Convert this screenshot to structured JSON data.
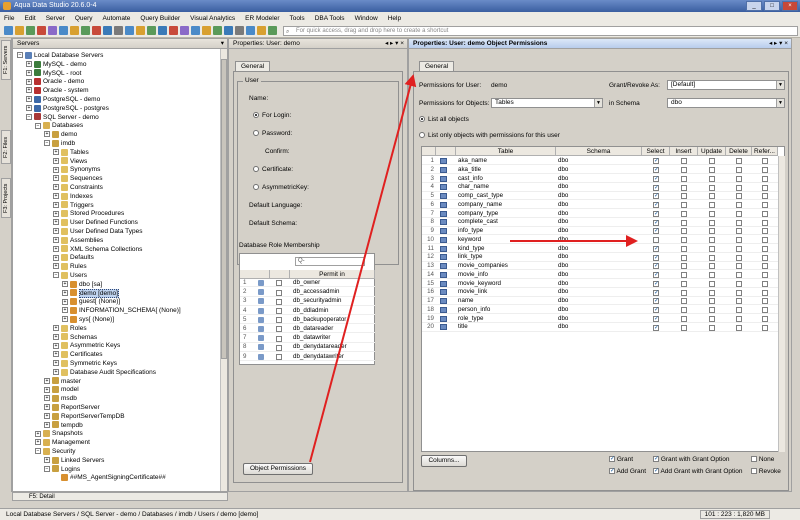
{
  "window": {
    "title": "Aqua Data Studio 20.6.0-4"
  },
  "menu": [
    "File",
    "Edit",
    "Server",
    "Query",
    "Automate",
    "Query Builder",
    "Visual Analytics",
    "ER Modeler",
    "Tools",
    "DBA Tools",
    "Window",
    "Help"
  ],
  "toolbar": {
    "shortcut_placeholder": "For quick access, drag and drop here to create a shortcut"
  },
  "vtabs": [
    "F1: Servers",
    "F2: Files",
    "F3: Projects"
  ],
  "servers": {
    "title": "Servers",
    "tree": [
      {
        "label": "Local Database Servers",
        "d": 0,
        "exp": "-",
        "ic": "#5a80b8"
      },
      {
        "label": "MySQL - demo",
        "d": 1,
        "exp": "+",
        "ic": "#3c7c3c"
      },
      {
        "label": "MySQL - root",
        "d": 1,
        "exp": "+",
        "ic": "#3c7c3c"
      },
      {
        "label": "Oracle - demo",
        "d": 1,
        "exp": "+",
        "ic": "#b83030"
      },
      {
        "label": "Oracle - system",
        "d": 1,
        "exp": "+",
        "ic": "#b83030"
      },
      {
        "label": "PostgreSQL - demo",
        "d": 1,
        "exp": "+",
        "ic": "#3c68a8"
      },
      {
        "label": "PostgreSQL - postgres",
        "d": 1,
        "exp": "+",
        "ic": "#3c68a8"
      },
      {
        "label": "SQL Server - demo",
        "d": 1,
        "exp": "-",
        "ic": "#a83838"
      },
      {
        "label": "Databases",
        "d": 2,
        "exp": "-",
        "ic": "#d8b050"
      },
      {
        "label": "demo",
        "d": 3,
        "exp": "+",
        "ic": "#c8a040"
      },
      {
        "label": "imdb",
        "d": 3,
        "exp": "-",
        "ic": "#c8a040"
      },
      {
        "label": "Tables",
        "d": 4,
        "exp": "+",
        "ic": "#e0c060"
      },
      {
        "label": "Views",
        "d": 4,
        "exp": "+",
        "ic": "#e0c060"
      },
      {
        "label": "Synonyms",
        "d": 4,
        "exp": "+",
        "ic": "#e0c060"
      },
      {
        "label": "Sequences",
        "d": 4,
        "exp": "+",
        "ic": "#e0c060"
      },
      {
        "label": "Constraints",
        "d": 4,
        "exp": "+",
        "ic": "#e0c060"
      },
      {
        "label": "Indexes",
        "d": 4,
        "exp": "+",
        "ic": "#e0c060"
      },
      {
        "label": "Triggers",
        "d": 4,
        "exp": "+",
        "ic": "#e0c060"
      },
      {
        "label": "Stored Procedures",
        "d": 4,
        "exp": "+",
        "ic": "#e0c060"
      },
      {
        "label": "User Defined Functions",
        "d": 4,
        "exp": "+",
        "ic": "#e0c060"
      },
      {
        "label": "User Defined Data Types",
        "d": 4,
        "exp": "+",
        "ic": "#e0c060"
      },
      {
        "label": "Assemblies",
        "d": 4,
        "exp": "+",
        "ic": "#e0c060"
      },
      {
        "label": "XML Schema Collections",
        "d": 4,
        "exp": "+",
        "ic": "#e0c060"
      },
      {
        "label": "Defaults",
        "d": 4,
        "exp": "+",
        "ic": "#e0c060"
      },
      {
        "label": "Rules",
        "d": 4,
        "exp": "+",
        "ic": "#e0c060"
      },
      {
        "label": "Users",
        "d": 4,
        "exp": "-",
        "ic": "#e0c060"
      },
      {
        "label": "dbo [sa]",
        "d": 5,
        "exp": "+",
        "ic": "#d89030"
      },
      {
        "label": "demo [demo]",
        "d": 5,
        "exp": "+",
        "ic": "#d89030",
        "sel": true
      },
      {
        "label": "guest[ (None)]",
        "d": 5,
        "exp": "+",
        "ic": "#d89030"
      },
      {
        "label": "INFORMATION_SCHEMA[ (None)]",
        "d": 5,
        "exp": "+",
        "ic": "#d89030"
      },
      {
        "label": "sys[ (None)]",
        "d": 5,
        "exp": "+",
        "ic": "#d89030"
      },
      {
        "label": "Roles",
        "d": 4,
        "exp": "+",
        "ic": "#e0c060"
      },
      {
        "label": "Schemas",
        "d": 4,
        "exp": "+",
        "ic": "#e0c060"
      },
      {
        "label": "Asymmetric Keys",
        "d": 4,
        "exp": "+",
        "ic": "#e0c060"
      },
      {
        "label": "Certificates",
        "d": 4,
        "exp": "+",
        "ic": "#e0c060"
      },
      {
        "label": "Symmetric Keys",
        "d": 4,
        "exp": "+",
        "ic": "#e0c060"
      },
      {
        "label": "Database Audit Specifications",
        "d": 4,
        "exp": "+",
        "ic": "#e0c060"
      },
      {
        "label": "master",
        "d": 3,
        "exp": "+",
        "ic": "#c8a040"
      },
      {
        "label": "model",
        "d": 3,
        "exp": "+",
        "ic": "#c8a040"
      },
      {
        "label": "msdb",
        "d": 3,
        "exp": "+",
        "ic": "#c8a040"
      },
      {
        "label": "ReportServer",
        "d": 3,
        "exp": "+",
        "ic": "#c8a040"
      },
      {
        "label": "ReportServerTempDB",
        "d": 3,
        "exp": "+",
        "ic": "#c8a040"
      },
      {
        "label": "tempdb",
        "d": 3,
        "exp": "+",
        "ic": "#c8a040"
      },
      {
        "label": "Snapshots",
        "d": 2,
        "exp": "+",
        "ic": "#d8b050"
      },
      {
        "label": "Management",
        "d": 2,
        "exp": "+",
        "ic": "#d8b050"
      },
      {
        "label": "Security",
        "d": 2,
        "exp": "-",
        "ic": "#d8b050"
      },
      {
        "label": "Linked Servers",
        "d": 3,
        "exp": "+",
        "ic": "#c8a040"
      },
      {
        "label": "Logins",
        "d": 3,
        "exp": "-",
        "ic": "#c8a040"
      },
      {
        "label": "##MS_AgentSigningCertificate##",
        "d": 4,
        "exp": "",
        "ic": "#d89030"
      }
    ],
    "fs_detail": "F5: Detail"
  },
  "props": {
    "title": "Properties: User: demo",
    "tab": "General",
    "group_user": "User",
    "name_label": "Name:",
    "for_login": "For Login:",
    "password": "Password:",
    "confirm": "Confirm:",
    "certificate": "Certificate:",
    "asym_key": "AsymmetricKey:",
    "default_language": "Default Language:",
    "default_schema": "Default Schema:",
    "role_membership": "Database Role Membership",
    "search_placeholder": "Q-",
    "permit_header": "Permit in",
    "roles": [
      "db_owner",
      "db_accessadmin",
      "db_securityadmin",
      "db_ddladmin",
      "db_backupoperator",
      "db_datareader",
      "db_datawriter",
      "db_denydatareader",
      "db_denydatawriter"
    ],
    "object_permissions_btn": "Object Permissions"
  },
  "objperm": {
    "title": "Properties: User: demo Object Permissions",
    "tab": "General",
    "perm_user_label": "Permissions for User:",
    "perm_user_value": "demo",
    "grant_revoke_label": "Grant/Revoke As:",
    "grant_revoke_value": "[Default]",
    "perm_objects_label": "Permissions for Objects:",
    "perm_objects_value": "Tables",
    "in_schema_label": "in Schema",
    "in_schema_value": "dbo",
    "list_all": "List all objects",
    "list_only": "List only objects with permissions for this user",
    "headers": [
      "Table",
      "Schema",
      "Select",
      "Insert",
      "Update",
      "Delete",
      "Refer..."
    ],
    "rows": [
      {
        "n": "1",
        "t": "aka_name",
        "s": "dbo",
        "sel": true
      },
      {
        "n": "2",
        "t": "aka_title",
        "s": "dbo",
        "sel": true
      },
      {
        "n": "3",
        "t": "cast_info",
        "s": "dbo",
        "sel": true
      },
      {
        "n": "4",
        "t": "char_name",
        "s": "dbo",
        "sel": true
      },
      {
        "n": "5",
        "t": "comp_cast_type",
        "s": "dbo",
        "sel": true
      },
      {
        "n": "6",
        "t": "company_name",
        "s": "dbo",
        "sel": true
      },
      {
        "n": "7",
        "t": "company_type",
        "s": "dbo",
        "sel": true
      },
      {
        "n": "8",
        "t": "complete_cast",
        "s": "dbo",
        "sel": true
      },
      {
        "n": "9",
        "t": "info_type",
        "s": "dbo",
        "sel": true
      },
      {
        "n": "10",
        "t": "keyword",
        "s": "dbo",
        "sel": false
      },
      {
        "n": "11",
        "t": "kind_type",
        "s": "dbo",
        "sel": true
      },
      {
        "n": "12",
        "t": "link_type",
        "s": "dbo",
        "sel": true
      },
      {
        "n": "13",
        "t": "movie_companies",
        "s": "dbo",
        "sel": true
      },
      {
        "n": "14",
        "t": "movie_info",
        "s": "dbo",
        "sel": true
      },
      {
        "n": "15",
        "t": "movie_keyword",
        "s": "dbo",
        "sel": true
      },
      {
        "n": "16",
        "t": "movie_link",
        "s": "dbo",
        "sel": true
      },
      {
        "n": "17",
        "t": "name",
        "s": "dbo",
        "sel": true
      },
      {
        "n": "18",
        "t": "person_info",
        "s": "dbo",
        "sel": true
      },
      {
        "n": "19",
        "t": "role_type",
        "s": "dbo",
        "sel": true
      },
      {
        "n": "20",
        "t": "title",
        "s": "dbo",
        "sel": true
      }
    ],
    "columns_btn": "Columns...",
    "legend": [
      "Grant",
      "Grant with Grant Option",
      "None",
      "Add Grant",
      "Add Grant with Grant Option",
      "Revoke"
    ]
  },
  "status": {
    "breadcrumb": "Local Database Servers / SQL Server - demo / Databases / imdb / Users / demo [demo]",
    "memory": "101 : 223 : 1,820 MB"
  }
}
